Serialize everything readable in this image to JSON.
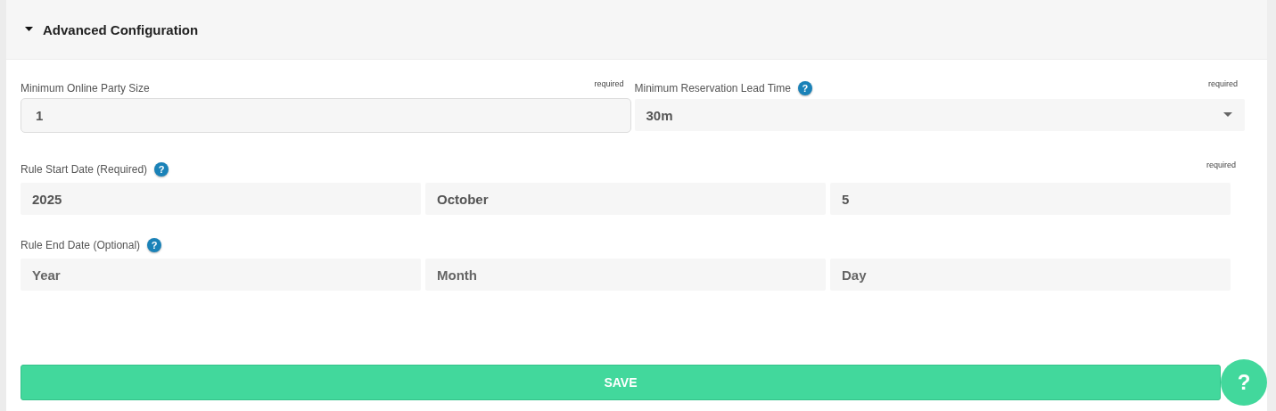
{
  "section": {
    "title": "Advanced Configuration",
    "expanded": true
  },
  "row_1": [
    {
      "kind": "input",
      "label": "Minimum Online Party Size",
      "required_note": "required",
      "value": "1"
    },
    {
      "kind": "select",
      "label": "Minimum Reservation Lead Time",
      "help": "?",
      "required_note": "required",
      "value": "30m"
    }
  ],
  "date_rows": [
    {
      "label": "Rule Start Date (Required)",
      "help": "?",
      "required_note": "required",
      "parts": [
        {
          "value": "2025"
        },
        {
          "value": "October"
        },
        {
          "value": "5"
        }
      ]
    },
    {
      "label": "Rule End Date (Optional)",
      "help": "?",
      "parts": [
        {
          "placeholder": "Year"
        },
        {
          "placeholder": "Month"
        },
        {
          "placeholder": "Day"
        }
      ]
    }
  ],
  "save_button": "SAVE",
  "help_button": "?"
}
